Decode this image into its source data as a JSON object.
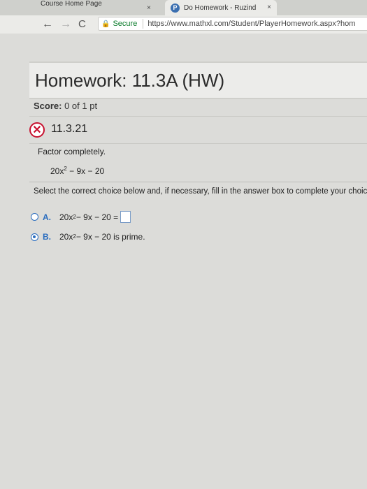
{
  "browser": {
    "tabs": [
      {
        "title": "Course Home Page",
        "close": "×"
      },
      {
        "title": "Do Homework - Ruzind",
        "close": "×"
      }
    ],
    "nav": {
      "back": "←",
      "forward": "→",
      "reload": "C"
    },
    "address": {
      "secure_label": "Secure",
      "url": "https://www.mathxl.com/Student/PlayerHomework.aspx?hom"
    }
  },
  "homework": {
    "title": "Homework: 11.3A (HW)",
    "score_label": "Score:",
    "score_value": "0 of 1 pt",
    "question_number": "11.3.21",
    "status_icon": "x-mark-icon",
    "instruction": "Factor completely.",
    "expression": {
      "base": "20x",
      "exp": "2",
      "rest": " − 9x − 20"
    },
    "prompt": "Select the correct choice below and, if necessary, fill in the answer box to complete your choic",
    "choices": [
      {
        "label": "A.",
        "text_base": "20x",
        "exp": "2",
        "text_rest": " − 9x − 20 =",
        "selected": false
      },
      {
        "label": "B.",
        "text_base": "20x",
        "exp": "2",
        "text_rest": " − 9x − 20 is prime.",
        "selected": true
      }
    ]
  },
  "colors": {
    "accent": "#2a6dbf",
    "error": "#c8102e",
    "secure": "#0b7c2b"
  }
}
